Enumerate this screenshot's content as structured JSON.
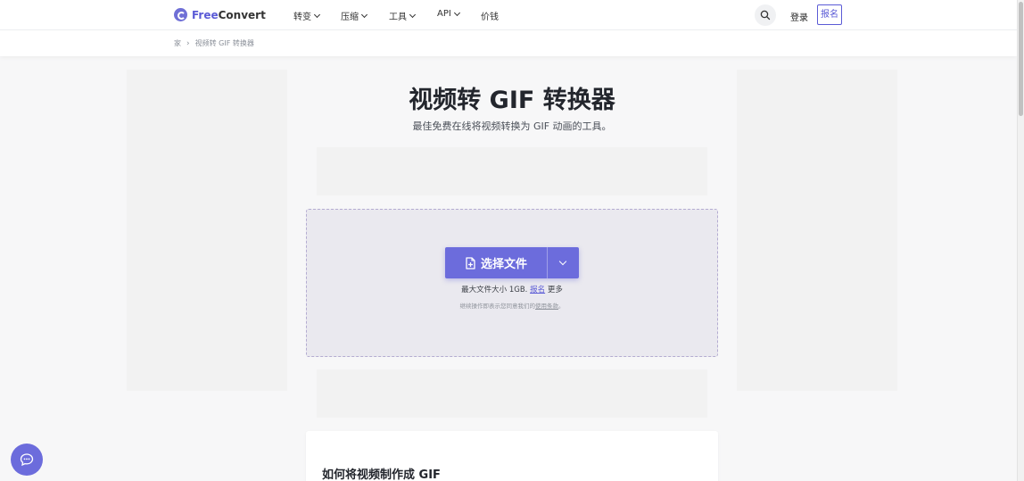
{
  "brand": {
    "free": "Free",
    "convert": "Convert"
  },
  "nav": [
    {
      "label": "转变",
      "dropdown": true
    },
    {
      "label": "压缩",
      "dropdown": true
    },
    {
      "label": "工具",
      "dropdown": true
    },
    {
      "label": "API",
      "dropdown": true
    },
    {
      "label": "价钱",
      "dropdown": false
    }
  ],
  "header": {
    "login": "登录",
    "signup": "报名"
  },
  "breadcrumb": {
    "home": "家",
    "current": "视频转 GIF 转换器"
  },
  "main": {
    "title": "视频转 GIF 转换器",
    "subtitle": "最佳免费在线将视频转换为 GIF 动画的工具。",
    "choose_files": "选择文件",
    "max_size_prefix": "最大文件大小 1GB.",
    "max_size_link": "报名",
    "max_size_suffix": "更多",
    "terms_prefix": "继续操作即表示您同意我们的",
    "terms_link": "使用条款",
    "terms_suffix": "。"
  },
  "howto": {
    "title": "如何将视频制作成 GIF"
  },
  "colors": {
    "accent": "#6c6cdc",
    "dropzone_bg": "#eae9ef",
    "ad_bg": "#f2f2f2"
  }
}
